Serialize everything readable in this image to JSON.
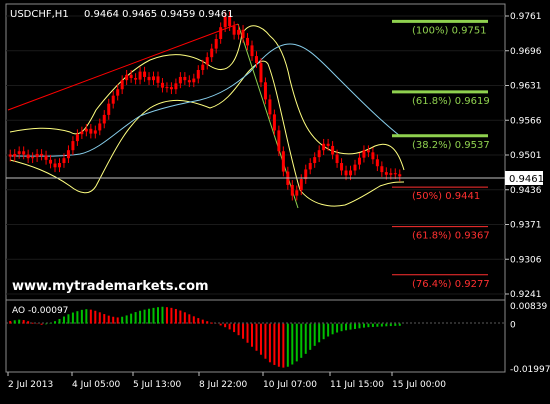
{
  "symbol_info": {
    "symbol": "USDCHF,H1",
    "ohlc": "0.9464 0.9465 0.9459 0.9461"
  },
  "watermark": "www.mytrademarkets.com",
  "current_price": "0.9461",
  "price_axis_labels": [
    "0.9761",
    "0.9696",
    "0.9631",
    "0.9566",
    "0.9501",
    "0.9436",
    "0.9371",
    "0.9306",
    "0.9241"
  ],
  "fib_levels": [
    {
      "label": "(100%) 0.9751",
      "color": "#8fd14f"
    },
    {
      "label": "(61.8%) 0.9619",
      "color": "#8fd14f"
    },
    {
      "label": "(38.2%) 0.9537",
      "color": "#8fd14f"
    },
    {
      "label": "(50%) 0.9441",
      "color": "#ff3030"
    },
    {
      "label": "(61.8%) 0.9367",
      "color": "#ff3030"
    },
    {
      "label": "(76.4%) 0.9277",
      "color": "#ff3030"
    }
  ],
  "ao_indicator": {
    "label": "AO -0.00097",
    "axis_labels": [
      "0.00839",
      "0",
      "-0.01997"
    ]
  },
  "time_axis_labels": [
    "2 Jul 2013",
    "4 Jul 05:00",
    "5 Jul 13:00",
    "8 Jul 22:00",
    "10 Jul 07:00",
    "11 Jul 15:00",
    "15 Jul 00:00"
  ],
  "colors": {
    "background": "#000000",
    "grid": "#ffffff",
    "candle": "#ff0000",
    "trendline": "#ff0000",
    "bollinger": "#ffff80",
    "moving_average": "#87ceeb",
    "ao_up": "#00c000",
    "ao_down": "#ff0000",
    "fib_up": "#8fd14f",
    "fib_down": "#ff3030"
  },
  "chart_data": {
    "type": "candlestick",
    "x_labels": [
      "2 Jul 2013",
      "4 Jul 05:00",
      "5 Jul 13:00",
      "8 Jul 22:00",
      "10 Jul 07:00",
      "11 Jul 15:00",
      "15 Jul 00:00"
    ],
    "y_range": [
      0.9241,
      0.9761
    ],
    "close": [
      0.9498,
      0.9503,
      0.9508,
      0.9502,
      0.9495,
      0.9497,
      0.9503,
      0.95,
      0.9492,
      0.9485,
      0.9478,
      0.9486,
      0.9495,
      0.951,
      0.9527,
      0.954,
      0.9545,
      0.955,
      0.9541,
      0.9547,
      0.956,
      0.9576,
      0.9597,
      0.9612,
      0.9624,
      0.9641,
      0.9651,
      0.9645,
      0.9642,
      0.9657,
      0.9647,
      0.9641,
      0.9648,
      0.9636,
      0.9627,
      0.9628,
      0.9624,
      0.9635,
      0.9647,
      0.9641,
      0.9637,
      0.9644,
      0.966,
      0.967,
      0.9684,
      0.97,
      0.9718,
      0.974,
      0.976,
      0.9742,
      0.9726,
      0.9735,
      0.972,
      0.9706,
      0.9686,
      0.9673,
      0.9637,
      0.9605,
      0.9577,
      0.9547,
      0.9508,
      0.947,
      0.9445,
      0.9425,
      0.9435,
      0.9456,
      0.9474,
      0.9486,
      0.9497,
      0.951,
      0.9522,
      0.9518,
      0.9502,
      0.9486,
      0.9472,
      0.9463,
      0.9472,
      0.9483,
      0.9496,
      0.951,
      0.9506,
      0.9493,
      0.948,
      0.9469,
      0.9464,
      0.9467,
      0.9465,
      0.9461
    ],
    "ao": [
      0.0012,
      0.0015,
      0.0018,
      0.0016,
      0.0011,
      0.0004,
      -0.0002,
      -0.0005,
      -0.0003,
      0.0003,
      0.0011,
      0.0021,
      0.0032,
      0.0042,
      0.005,
      0.0056,
      0.0062,
      0.0065,
      0.0063,
      0.0058,
      0.0051,
      0.0043,
      0.0036,
      0.0031,
      0.0028,
      0.0031,
      0.0037,
      0.0045,
      0.0052,
      0.0058,
      0.0063,
      0.0067,
      0.0071,
      0.0074,
      0.0076,
      0.0074,
      0.0071,
      0.0066,
      0.0059,
      0.0051,
      0.0042,
      0.0033,
      0.0025,
      0.0018,
      0.0011,
      0.0005,
      -0.0001,
      -0.0008,
      -0.0016,
      -0.0026,
      -0.0038,
      -0.0052,
      -0.0068,
      -0.0086,
      -0.0104,
      -0.0122,
      -0.014,
      -0.0158,
      -0.0174,
      -0.0186,
      -0.0194,
      -0.0198,
      -0.0194,
      -0.0184,
      -0.017,
      -0.0154,
      -0.0136,
      -0.0118,
      -0.01,
      -0.0084,
      -0.007,
      -0.0058,
      -0.0048,
      -0.004,
      -0.0034,
      -0.003,
      -0.0027,
      -0.0024,
      -0.0021,
      -0.0018,
      -0.0016,
      -0.0015,
      -0.0014,
      -0.0013,
      -0.0012,
      -0.0011,
      -0.001,
      -0.00097
    ],
    "ao_range": [
      -0.01997,
      0.00839
    ]
  }
}
